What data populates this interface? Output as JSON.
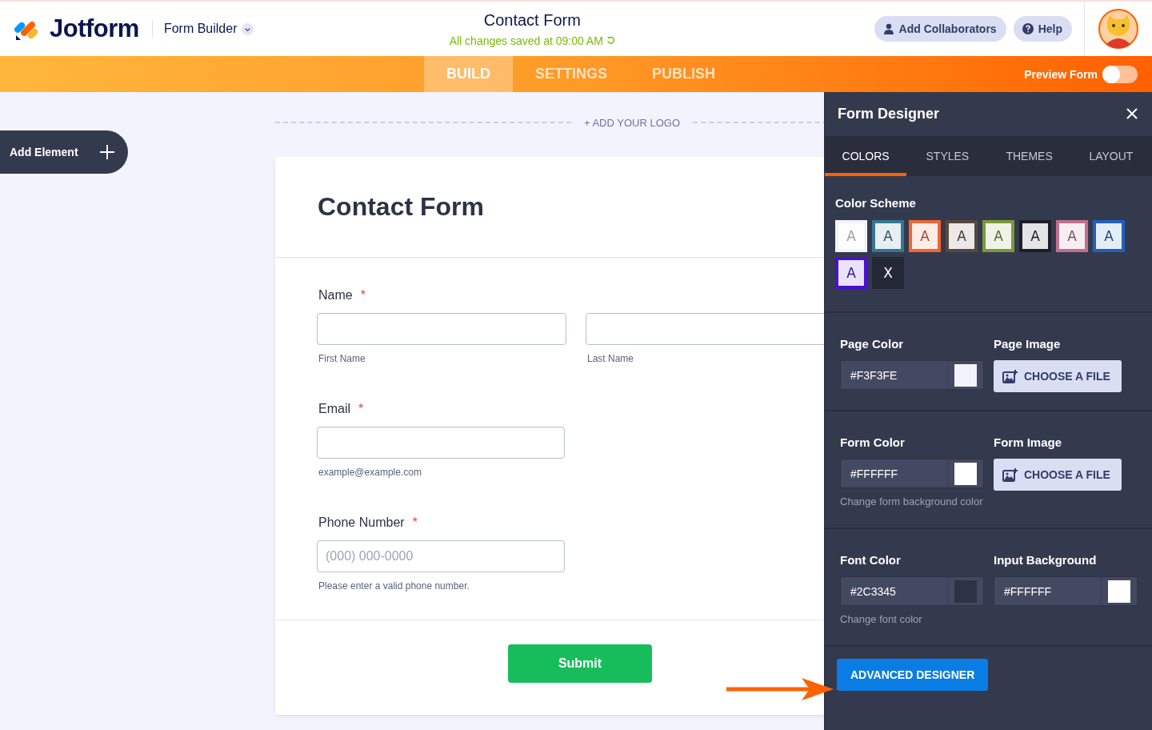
{
  "header": {
    "logo_text": "Jotform",
    "product_menu": "Form Builder",
    "form_title": "Contact Form",
    "save_status": "All changes saved at 09:00 AM",
    "buttons": [
      {
        "label": "Add Collaborators",
        "kind": "user"
      },
      {
        "label": "Help",
        "kind": "help"
      }
    ]
  },
  "nav": {
    "tabs": [
      {
        "label": "BUILD",
        "selected": true
      },
      {
        "label": "SETTINGS",
        "selected": false
      },
      {
        "label": "PUBLISH",
        "selected": false
      }
    ],
    "preview": {
      "label": "Preview Form",
      "on": false
    }
  },
  "add_element": {
    "label": "Add Element"
  },
  "form": {
    "logo_prompt": "+ ADD YOUR LOGO",
    "title": "Contact Form",
    "fields": [
      {
        "label": "Name",
        "required_mark": "*",
        "inputs": [
          {
            "sublabel": "First Name"
          },
          {
            "sublabel": "Last Name"
          }
        ]
      },
      {
        "label": "Email",
        "required_mark": "*",
        "inputs": [
          {
            "sublabel": "example@example.com"
          }
        ]
      },
      {
        "label": "Phone Number",
        "required_mark": "*",
        "inputs": [
          {
            "placeholder": "(000) 000-0000",
            "sublabel": "Please enter a valid phone number."
          }
        ]
      }
    ],
    "submit": "Submit"
  },
  "designer": {
    "title": "Form Designer",
    "tabs": [
      {
        "label": "COLORS",
        "selected": true
      },
      {
        "label": "STYLES",
        "selected": false
      },
      {
        "label": "THEMES",
        "selected": false
      },
      {
        "label": "LAYOUT",
        "selected": false
      }
    ],
    "color_scheme": {
      "label": "Color Scheme",
      "swatches": [
        {
          "kind": "scheme",
          "letter": "A",
          "color": "#f3f3fe"
        },
        {
          "kind": "scheme",
          "letter": "A",
          "color": "#367793"
        },
        {
          "kind": "scheme",
          "letter": "A",
          "color": "#f26532"
        },
        {
          "kind": "scheme",
          "letter": "A",
          "color": "#57473e"
        },
        {
          "kind": "scheme",
          "letter": "A",
          "color": "#7a9a3a"
        },
        {
          "kind": "scheme",
          "letter": "A",
          "color": "#1d1e2a"
        },
        {
          "kind": "scheme",
          "letter": "A",
          "color": "#c0708f"
        },
        {
          "kind": "scheme",
          "letter": "A",
          "color": "#215fba"
        },
        {
          "kind": "scheme",
          "letter": "A",
          "color": "#4a0fcf"
        },
        {
          "kind": "none",
          "letter": "X"
        }
      ]
    },
    "sections": [
      [
        {
          "kind": "color",
          "label": "Page Color",
          "value": "#F3F3FE",
          "color": "#f3f3fe"
        },
        {
          "kind": "file",
          "label": "Page Image",
          "button": "CHOOSE A FILE"
        }
      ],
      [
        {
          "kind": "color",
          "label": "Form Color",
          "value": "#FFFFFF",
          "color": "#ffffff",
          "hint": "Change form background color"
        },
        {
          "kind": "file",
          "label": "Form Image",
          "button": "CHOOSE A FILE"
        }
      ],
      [
        {
          "kind": "color",
          "label": "Font Color",
          "value": "#2C3345",
          "color": "#2c3345",
          "hint": "Change font color"
        },
        {
          "kind": "color",
          "label": "Input Background",
          "value": "#FFFFFF",
          "color": "#ffffff"
        }
      ]
    ],
    "advanced_button": "ADVANCED DESIGNER"
  }
}
